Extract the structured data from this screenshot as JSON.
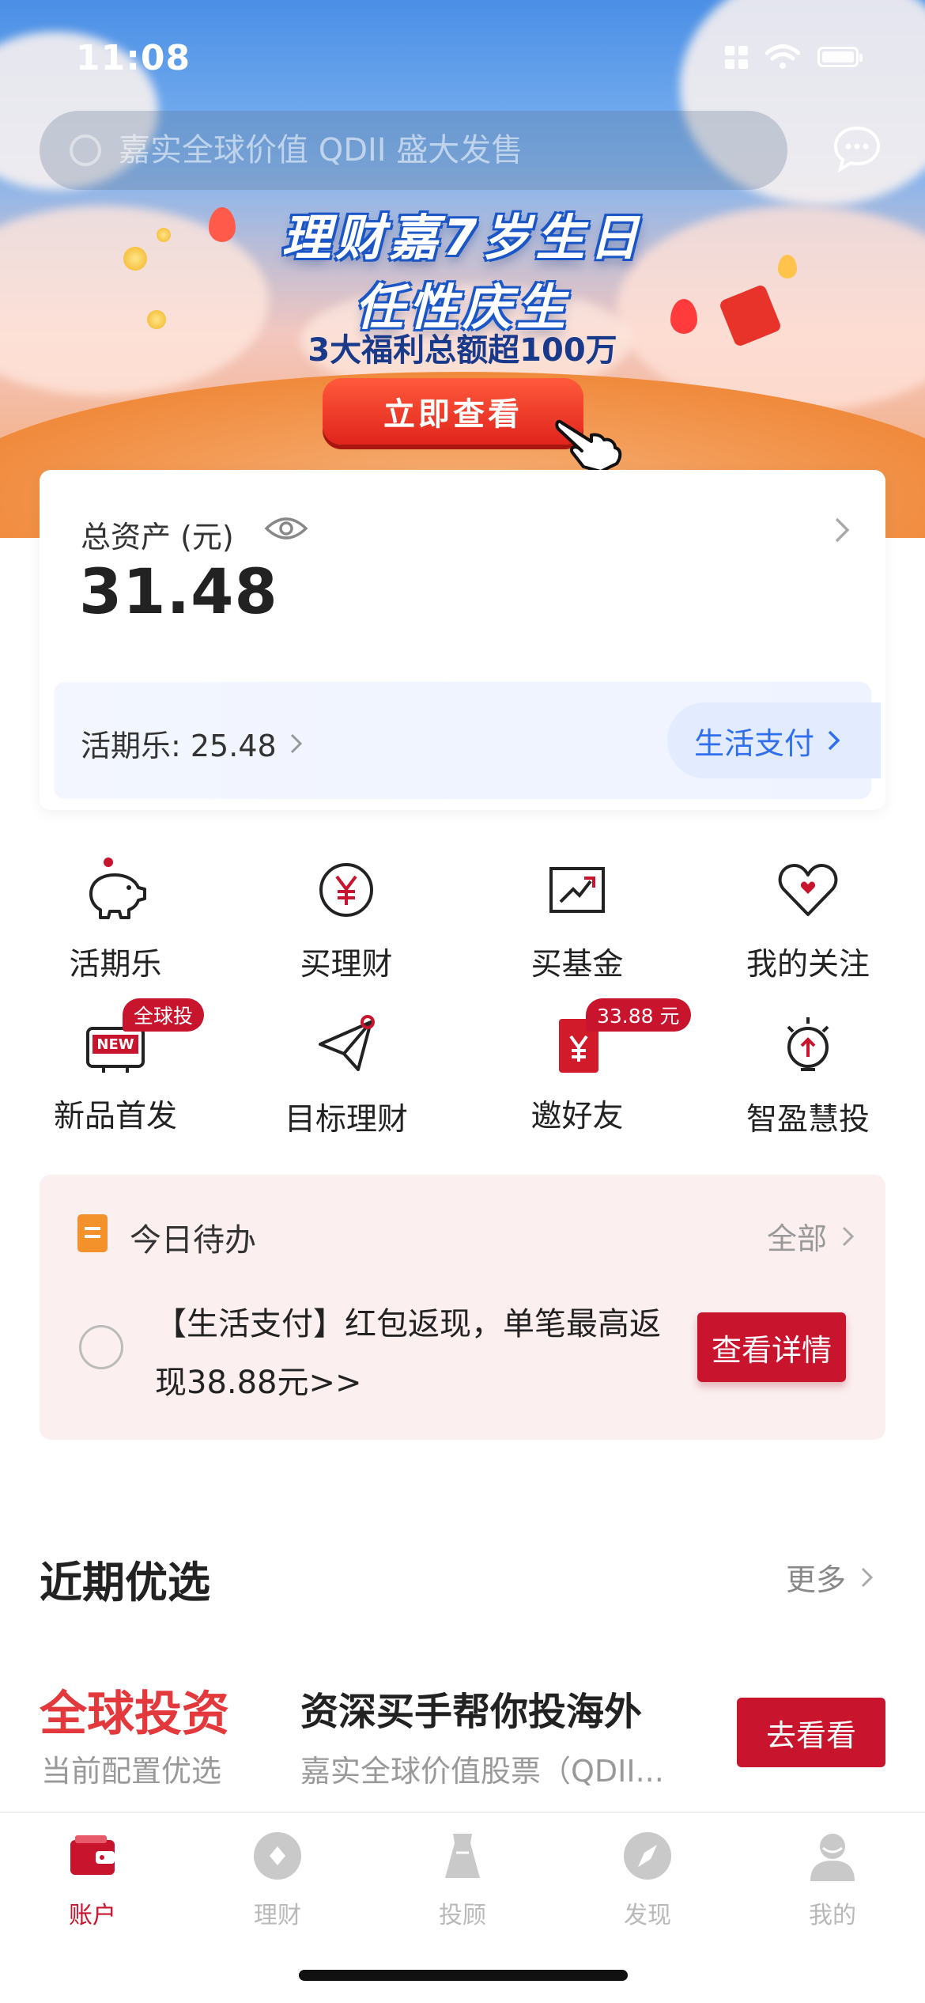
{
  "status_bar": {
    "time": "11:08"
  },
  "search": {
    "placeholder": "嘉实全球价值 QDII 盛大发售"
  },
  "banner": {
    "title_line1": "理财嘉7岁生日",
    "title_line2": "任性庆生",
    "subtitle": "3大福利总额超100万",
    "button": "立即查看"
  },
  "assets": {
    "label": "总资产 (元)",
    "value": "31.48",
    "huoqi_label": "活期乐: 25.48",
    "life_pay_button": "生活支付"
  },
  "grid": [
    {
      "label": "活期乐",
      "icon": "piggy-bank-icon"
    },
    {
      "label": "买理财",
      "icon": "yen-circle-icon"
    },
    {
      "label": "买基金",
      "icon": "chart-up-icon"
    },
    {
      "label": "我的关注",
      "icon": "heart-icon"
    },
    {
      "label": "新品首发",
      "icon": "new-product-icon",
      "badge": "全球投"
    },
    {
      "label": "目标理财",
      "icon": "paper-plane-icon"
    },
    {
      "label": "邀好友",
      "icon": "red-envelope-icon",
      "badge": "33.88 元"
    },
    {
      "label": "智盈慧投",
      "icon": "bulb-icon"
    }
  ],
  "todo": {
    "title": "今日待办",
    "all_link": "全部",
    "item_text": "【生活支付】红包返现，单笔最高返现38.88元>>",
    "action_button": "查看详情"
  },
  "recommend": {
    "title": "近期优选",
    "more": "更多",
    "tag": "全球投资",
    "tag_sub": "当前配置优选",
    "headline": "资深买手帮你投海外",
    "fund_name": "嘉实全球价值股票（QDII...",
    "button": "去看看"
  },
  "tabs": [
    {
      "label": "账户",
      "icon": "wallet-icon",
      "active": true
    },
    {
      "label": "理财",
      "icon": "diamond-icon",
      "active": false
    },
    {
      "label": "投顾",
      "icon": "cup-icon",
      "active": false
    },
    {
      "label": "发现",
      "icon": "compass-icon",
      "active": false
    },
    {
      "label": "我的",
      "icon": "user-icon",
      "active": false
    }
  ],
  "colors": {
    "brand_red": "#c8142d",
    "link_blue": "#2f6ff0",
    "todo_bg": "#fbeff0"
  }
}
